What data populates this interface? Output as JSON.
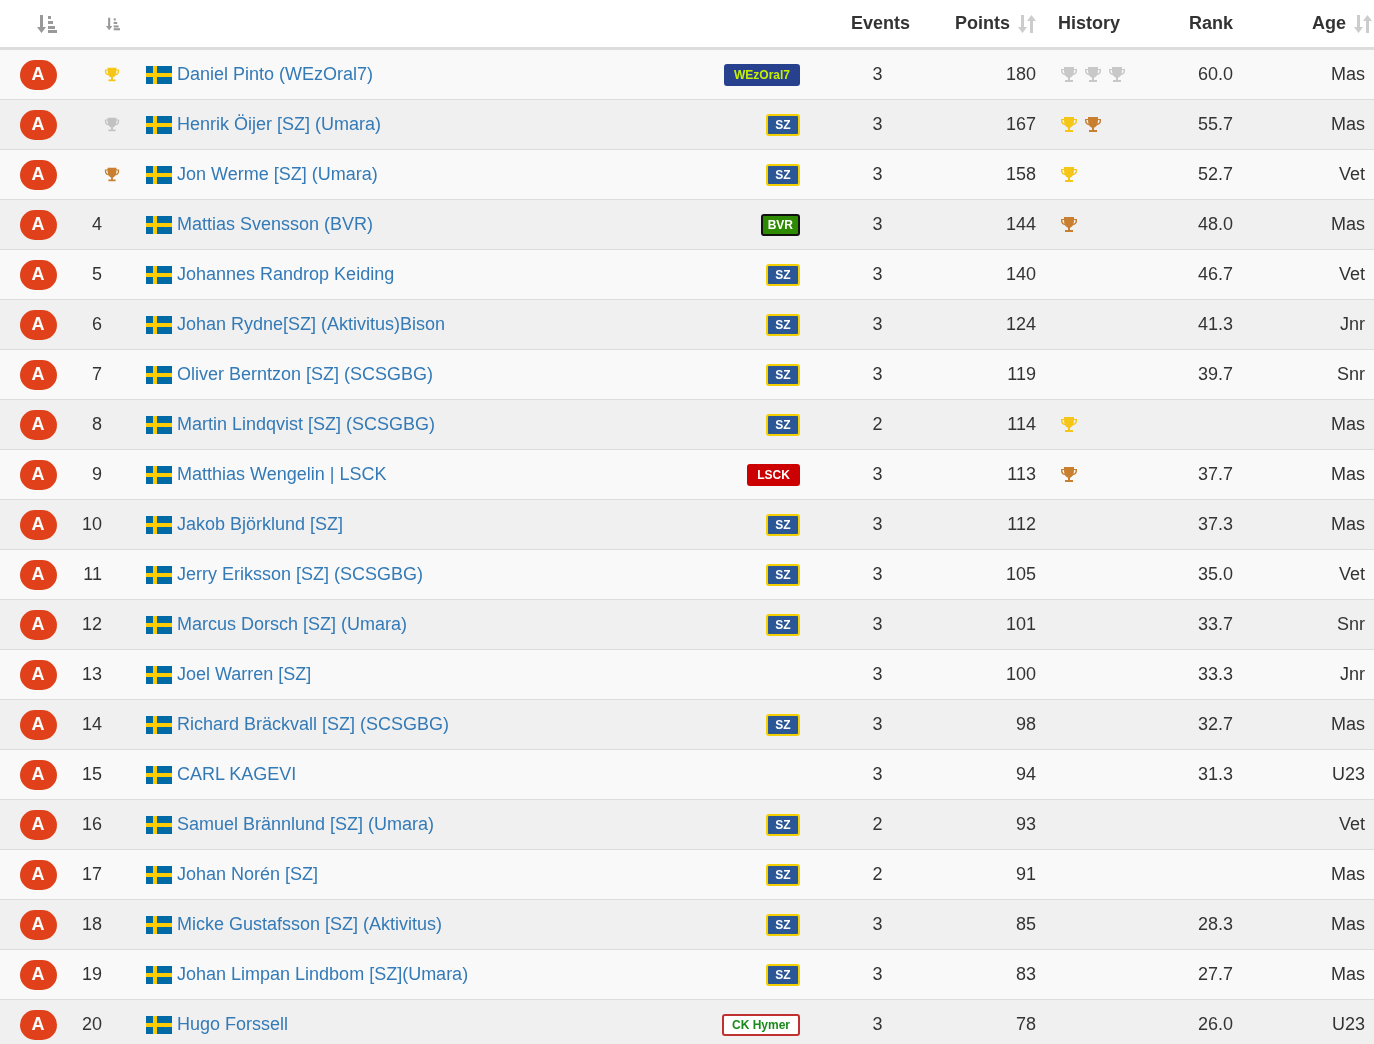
{
  "header": {
    "columns": [
      {
        "label": "Events",
        "sortable": false
      },
      {
        "label": "Points",
        "sortable": true
      },
      {
        "label": "History",
        "sortable": false
      },
      {
        "label": "Rank",
        "sortable": false
      },
      {
        "label": "Age",
        "sortable": true
      }
    ]
  },
  "rows": [
    {
      "category": "A",
      "place": {
        "kind": "trophy",
        "color": "#f5c518"
      },
      "name": "Daniel Pinto (WEzOral7)",
      "team": {
        "text": "WEzOral7",
        "kind": "wezoral"
      },
      "events": "3",
      "points": "180",
      "history": [
        {
          "color": "#c8c8c8"
        },
        {
          "color": "#c8c8c8"
        },
        {
          "color": "#c8c8c8"
        }
      ],
      "rank": "60.0",
      "age": "Mas"
    },
    {
      "category": "A",
      "place": {
        "kind": "trophy",
        "color": "#c2c2c2"
      },
      "name": "Henrik Öijer [SZ] (Umara)",
      "team": {
        "text": "SZ",
        "kind": "sz"
      },
      "events": "3",
      "points": "167",
      "history": [
        {
          "color": "#f5c518"
        },
        {
          "color": "#c87f30"
        }
      ],
      "rank": "55.7",
      "age": "Mas"
    },
    {
      "category": "A",
      "place": {
        "kind": "trophy",
        "color": "#c87f30"
      },
      "name": "Jon Werme [SZ] (Umara)",
      "team": {
        "text": "SZ",
        "kind": "sz"
      },
      "events": "3",
      "points": "158",
      "history": [
        {
          "color": "#f5c518"
        }
      ],
      "rank": "52.7",
      "age": "Vet"
    },
    {
      "category": "A",
      "place": {
        "kind": "number",
        "text": "4"
      },
      "name": "Mattias Svensson (BVR)",
      "team": {
        "text": "BVR",
        "kind": "bvr"
      },
      "events": "3",
      "points": "144",
      "history": [
        {
          "color": "#c87f30"
        }
      ],
      "rank": "48.0",
      "age": "Mas"
    },
    {
      "category": "A",
      "place": {
        "kind": "number",
        "text": "5"
      },
      "name": "Johannes Randrop Keiding",
      "team": {
        "text": "SZ",
        "kind": "sz"
      },
      "events": "3",
      "points": "140",
      "rank": "46.7",
      "age": "Vet"
    },
    {
      "category": "A",
      "place": {
        "kind": "number",
        "text": "6"
      },
      "name": "Johan Rydne[SZ] (Aktivitus)Bison",
      "team": {
        "text": "SZ",
        "kind": "sz"
      },
      "events": "3",
      "points": "124",
      "rank": "41.3",
      "age": "Jnr"
    },
    {
      "category": "A",
      "place": {
        "kind": "number",
        "text": "7"
      },
      "name": "Oliver Berntzon [SZ] (SCSGBG)",
      "team": {
        "text": "SZ",
        "kind": "sz"
      },
      "events": "3",
      "points": "119",
      "rank": "39.7",
      "age": "Snr"
    },
    {
      "category": "A",
      "place": {
        "kind": "number",
        "text": "8"
      },
      "name": "Martin Lindqvist [SZ] (SCSGBG)",
      "team": {
        "text": "SZ",
        "kind": "sz"
      },
      "events": "2",
      "points": "114",
      "history": [
        {
          "color": "#f5c518"
        }
      ],
      "age": "Mas"
    },
    {
      "category": "A",
      "place": {
        "kind": "number",
        "text": "9"
      },
      "name": "Matthias Wengelin | LSCK",
      "team": {
        "text": "LSCK",
        "kind": "lsck"
      },
      "events": "3",
      "points": "113",
      "history": [
        {
          "color": "#c87f30"
        }
      ],
      "rank": "37.7",
      "age": "Mas"
    },
    {
      "category": "A",
      "place": {
        "kind": "number",
        "text": "10"
      },
      "name": "Jakob Björklund [SZ]",
      "team": {
        "text": "SZ",
        "kind": "sz"
      },
      "events": "3",
      "points": "112",
      "rank": "37.3",
      "age": "Mas"
    },
    {
      "category": "A",
      "place": {
        "kind": "number",
        "text": "11"
      },
      "name": "Jerry Eriksson [SZ] (SCSGBG)",
      "team": {
        "text": "SZ",
        "kind": "sz"
      },
      "events": "3",
      "points": "105",
      "rank": "35.0",
      "age": "Vet"
    },
    {
      "category": "A",
      "place": {
        "kind": "number",
        "text": "12"
      },
      "name": "Marcus Dorsch [SZ] (Umara)",
      "team": {
        "text": "SZ",
        "kind": "sz"
      },
      "events": "3",
      "points": "101",
      "rank": "33.7",
      "age": "Snr"
    },
    {
      "category": "A",
      "place": {
        "kind": "number",
        "text": "13"
      },
      "name": "Joel Warren [SZ]",
      "events": "3",
      "points": "100",
      "rank": "33.3",
      "age": "Jnr"
    },
    {
      "category": "A",
      "place": {
        "kind": "number",
        "text": "14"
      },
      "name": "Richard Bräckvall [SZ] (SCSGBG)",
      "team": {
        "text": "SZ",
        "kind": "sz"
      },
      "events": "3",
      "points": "98",
      "rank": "32.7",
      "age": "Mas"
    },
    {
      "category": "A",
      "place": {
        "kind": "number",
        "text": "15"
      },
      "name": "CARL KAGEVI",
      "events": "3",
      "points": "94",
      "rank": "31.3",
      "age": "U23"
    },
    {
      "category": "A",
      "place": {
        "kind": "number",
        "text": "16"
      },
      "name": "Samuel Brännlund [SZ] (Umara)",
      "team": {
        "text": "SZ",
        "kind": "sz"
      },
      "events": "2",
      "points": "93",
      "age": "Vet"
    },
    {
      "category": "A",
      "place": {
        "kind": "number",
        "text": "17"
      },
      "name": "Johan Norén [SZ]",
      "team": {
        "text": "SZ",
        "kind": "sz"
      },
      "events": "2",
      "points": "91",
      "age": "Mas"
    },
    {
      "category": "A",
      "place": {
        "kind": "number",
        "text": "18"
      },
      "name": "Micke Gustafsson [SZ] (Aktivitus)",
      "team": {
        "text": "SZ",
        "kind": "sz"
      },
      "events": "3",
      "points": "85",
      "rank": "28.3",
      "age": "Mas"
    },
    {
      "category": "A",
      "place": {
        "kind": "number",
        "text": "19"
      },
      "name": "Johan Limpan Lindbom [SZ](Umara)",
      "team": {
        "text": "SZ",
        "kind": "sz"
      },
      "events": "3",
      "points": "83",
      "rank": "27.7",
      "age": "Mas"
    },
    {
      "category": "A",
      "place": {
        "kind": "number",
        "text": "20"
      },
      "name": "Hugo Forssell",
      "team": {
        "text": "CK Hymer",
        "kind": "hymer"
      },
      "events": "3",
      "points": "78",
      "rank": "26.0",
      "age": "U23"
    }
  ]
}
